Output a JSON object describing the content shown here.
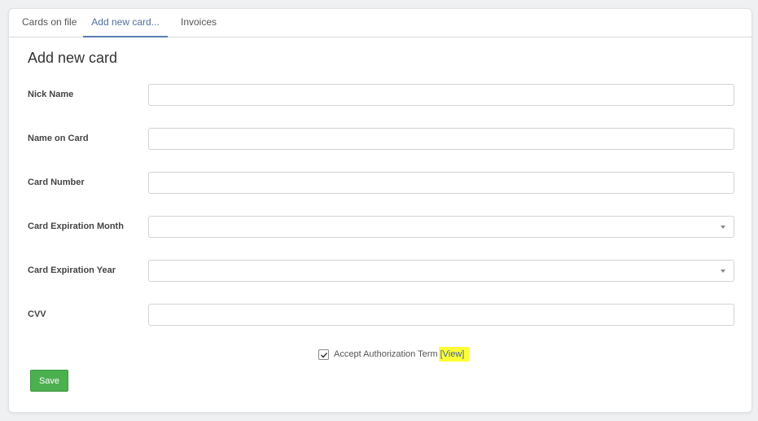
{
  "tabs": [
    {
      "label": "Cards on file"
    },
    {
      "label": "Add new card..."
    },
    {
      "label": "Invoices"
    }
  ],
  "page_title": "Add new card",
  "form": {
    "nick_name_label": "Nick Name",
    "name_on_card_label": "Name on Card",
    "card_number_label": "Card Number",
    "exp_month_label": "Card Expiration Month",
    "exp_year_label": "Card Expiration Year",
    "cvv_label": "CVV"
  },
  "accept": {
    "label": "Accept Authorization Term",
    "view_link": "[View]",
    "checked": true
  },
  "save_label": "Save",
  "colors": {
    "accent": "#5a7bb0",
    "save": "#4caf50",
    "highlight": "#ffff36"
  }
}
